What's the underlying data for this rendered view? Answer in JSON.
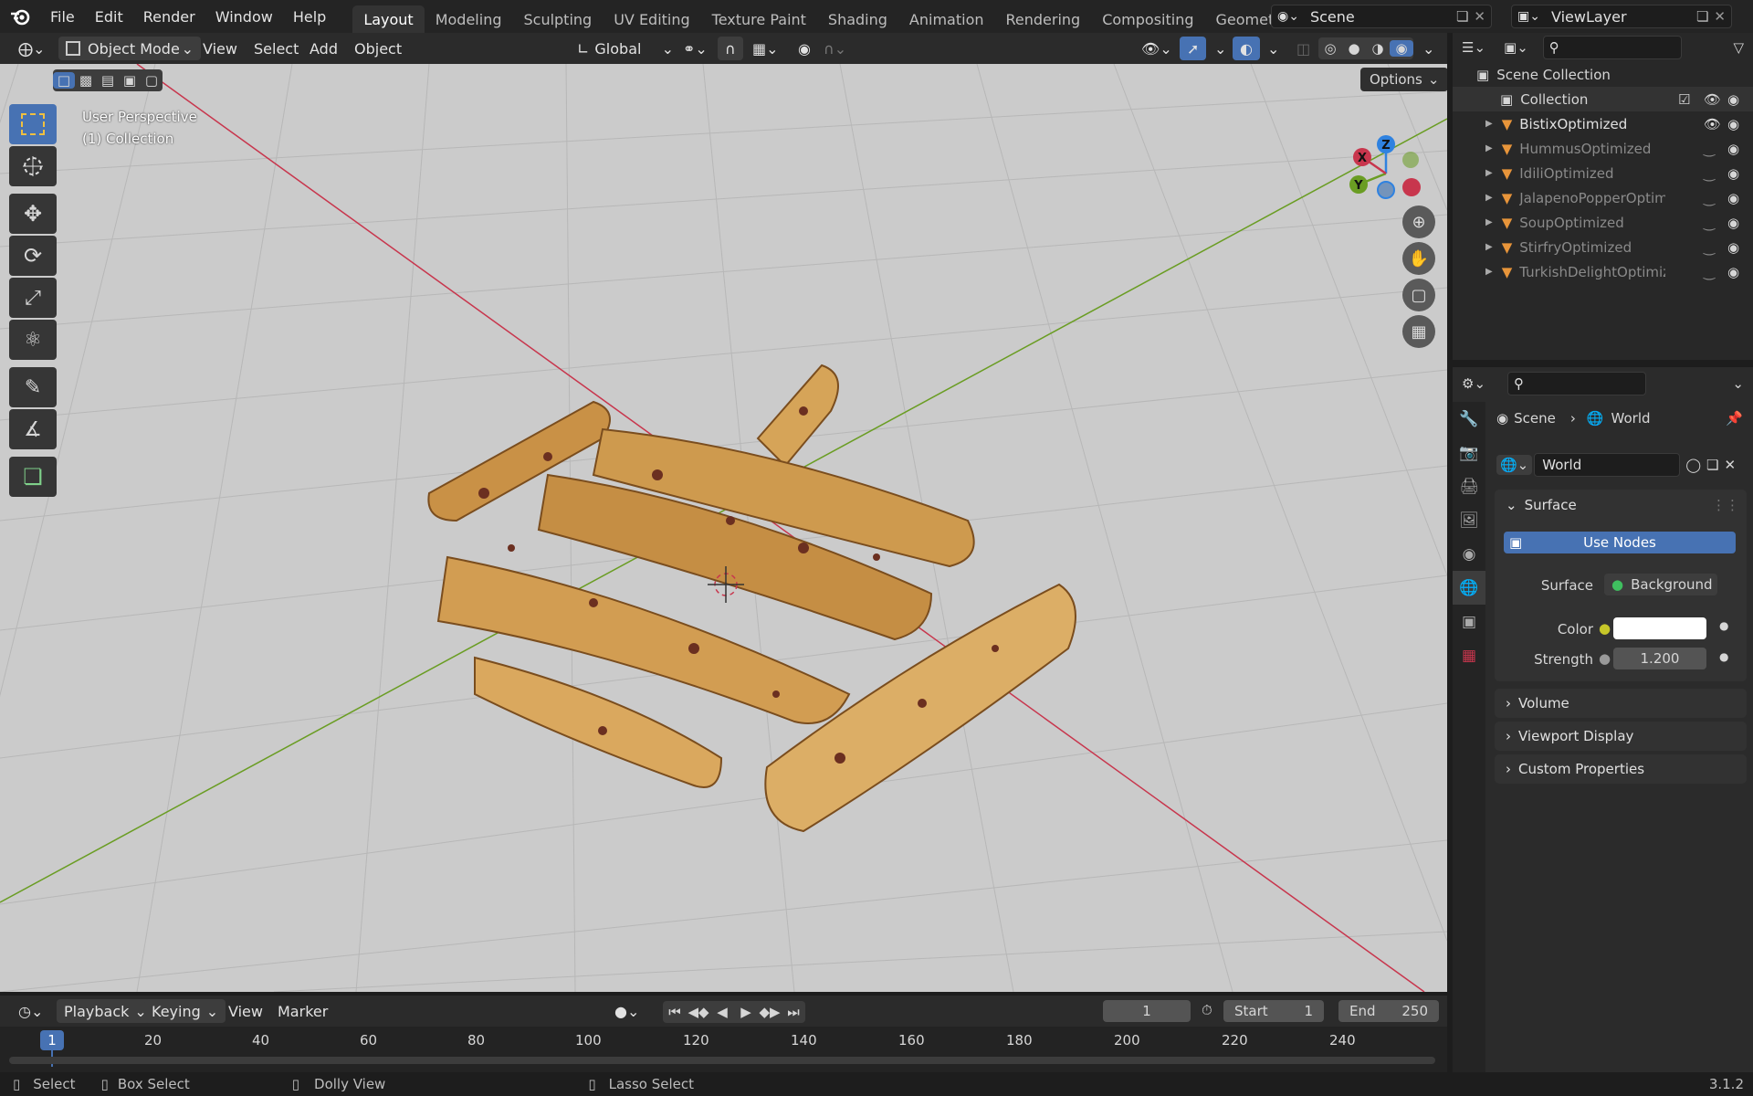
{
  "topbar": {
    "menus": [
      "File",
      "Edit",
      "Render",
      "Window",
      "Help"
    ],
    "workspaces": [
      "Layout",
      "Modeling",
      "Sculpting",
      "UV Editing",
      "Texture Paint",
      "Shading",
      "Animation",
      "Rendering",
      "Compositing",
      "Geometry Nodes"
    ],
    "active_workspace": "Layout",
    "scene": "Scene",
    "view_layer": "ViewLayer"
  },
  "viewport_header": {
    "mode": "Object Mode",
    "menus": [
      "View",
      "Select",
      "Add",
      "Object"
    ],
    "transform_orientation": "Global",
    "options": "Options"
  },
  "viewport": {
    "overlay_line1": "User Perspective",
    "overlay_line2": "(1) Collection",
    "gizmo": {
      "x": "X",
      "y": "Y",
      "z": "Z"
    }
  },
  "outliner": {
    "root": "Scene Collection",
    "collection": "Collection",
    "objects": [
      {
        "name": "BistixOptimized",
        "visible": true
      },
      {
        "name": "HummusOptimized",
        "visible": false
      },
      {
        "name": "IdiliOptimized",
        "visible": false
      },
      {
        "name": "JalapenoPopperOptimi",
        "visible": false
      },
      {
        "name": "SoupOptimized",
        "visible": false
      },
      {
        "name": "StirfryOptimized",
        "visible": false
      },
      {
        "name": "TurkishDelightOptimiz",
        "visible": false
      }
    ]
  },
  "properties": {
    "breadcrumb_scene": "Scene",
    "breadcrumb_world": "World",
    "world_name": "World",
    "surface_panel": "Surface",
    "use_nodes": "Use Nodes",
    "surface_label": "Surface",
    "surface_value": "Background",
    "color_label": "Color",
    "strength_label": "Strength",
    "strength_value": "1.200",
    "panels": [
      "Volume",
      "Viewport Display",
      "Custom Properties"
    ]
  },
  "timeline": {
    "menus": [
      "Playback",
      "Keying",
      "View",
      "Marker"
    ],
    "current_frame": "1",
    "start_label": "Start",
    "start_value": "1",
    "end_label": "End",
    "end_value": "250",
    "ruler": [
      "20",
      "40",
      "60",
      "80",
      "100",
      "120",
      "140",
      "160",
      "180",
      "200",
      "220",
      "240"
    ],
    "playhead": "1"
  },
  "status": {
    "select": "Select",
    "box_select": "Box Select",
    "dolly_view": "Dolly View",
    "lasso_select": "Lasso Select",
    "version": "3.1.2"
  },
  "colors": {
    "accent": "#4772b3",
    "x_axis": "#c8364d",
    "y_axis": "#6a9d23",
    "z_axis": "#2f82e0",
    "viewport_bg": "#c9c9c9"
  }
}
